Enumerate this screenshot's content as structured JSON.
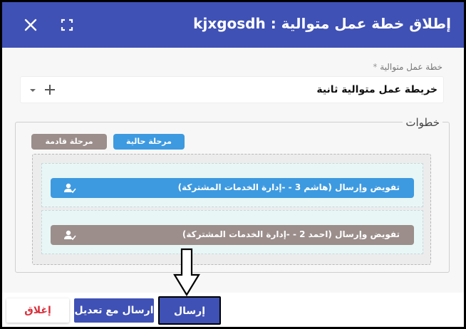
{
  "dialog": {
    "title": "إطلاق خطة عمل متوالية : kjxgosdh"
  },
  "form": {
    "field_label": "خطة عمل متوالية",
    "required_mark": "*",
    "selected_value": "خريطة عمل متوالية ثانية"
  },
  "steps": {
    "legend": "خطوات",
    "chips": {
      "current": "مرحلة حالية",
      "upcoming": "مرحلة قادمة"
    },
    "items": [
      {
        "label": "تفويض وإرسال (هاشم 3 - -إدارة الخدمات المشتركة)",
        "status": "current"
      },
      {
        "label": "تفويض وإرسال (احمد 2 - -إدارة الخدمات المشتركة)",
        "status": "upcoming"
      }
    ]
  },
  "footer": {
    "close_label": "إغلاق",
    "send_with_edit_label": "ارسال مع تعديل",
    "send_label": "إرسال"
  },
  "icons": {
    "close": "close-icon",
    "fullscreen": "fullscreen-icon",
    "dropdown": "chevron-down-icon",
    "add": "plus-icon",
    "assignee": "user-check-icon",
    "annotation": "down-arrow-annotation"
  },
  "colors": {
    "header": "#3f51b5",
    "current_stage": "#3d9ae0",
    "upcoming_stage": "#9b8e8b",
    "close_text": "#d9303b"
  }
}
